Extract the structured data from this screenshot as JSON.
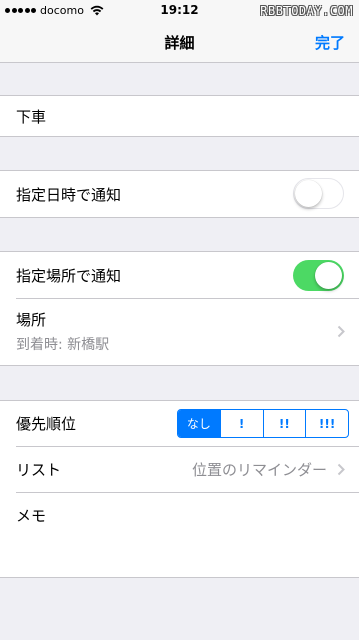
{
  "status_bar": {
    "carrier": "docomo",
    "time": "19:12",
    "watermark": "RBBTODAY.COM"
  },
  "nav": {
    "title": "詳細",
    "done_label": "完了"
  },
  "reminder": {
    "title": "下車"
  },
  "date_alert": {
    "label": "指定日時で通知",
    "enabled": false
  },
  "location_alert": {
    "label": "指定場所で通知",
    "enabled": true,
    "location_label": "場所",
    "location_value": "到着時: 新橋駅"
  },
  "priority": {
    "label": "優先順位",
    "options": [
      "なし",
      "!",
      "!!",
      "!!!"
    ],
    "selected": "なし"
  },
  "list": {
    "label": "リスト",
    "value": "位置のリマインダー"
  },
  "memo": {
    "label": "メモ"
  },
  "colors": {
    "accent": "#007aff",
    "switch_on": "#4cd964",
    "background": "#efeff4"
  }
}
